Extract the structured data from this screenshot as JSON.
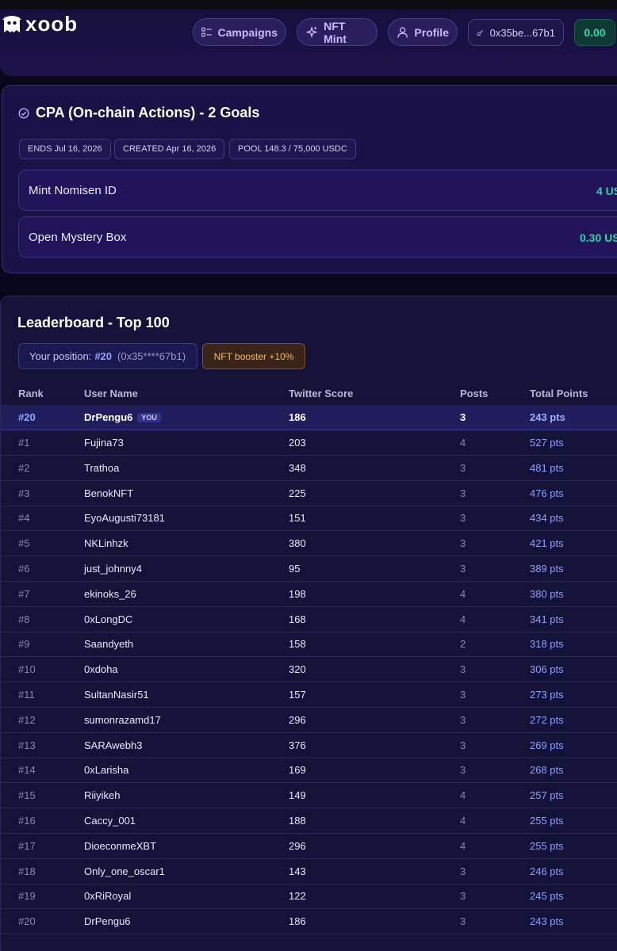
{
  "brand": {
    "name": "xoob"
  },
  "nav": {
    "campaigns": "Campaigns",
    "nft_mint": "NFT Mint",
    "profile": "Profile",
    "wallet": "0x35be...67b1",
    "balance": "0.00"
  },
  "cpa": {
    "title": "CPA (On-chain Actions) - 2 Goals",
    "chips": [
      "ENDS Jul 16, 2026",
      "CREATED Apr 16, 2026",
      "POOL 148.3 / 75,000 USDC"
    ],
    "goals": [
      {
        "name": "Mint Nomisen ID",
        "reward": "4 US"
      },
      {
        "name": "Open Mystery Box",
        "reward": "0.30 US"
      }
    ]
  },
  "leaderboard": {
    "title": "Leaderboard - Top 100",
    "position_label": "Your position:",
    "position_rank": "#20",
    "position_address": "(0x35****67b1)",
    "booster": "NFT booster +10%",
    "columns": [
      "Rank",
      "User Name",
      "Twitter Score",
      "Posts",
      "Total Points"
    ],
    "you_badge": "YOU",
    "me_row": {
      "rank": "#20",
      "user": "DrPengu6",
      "score": "186",
      "posts": "3",
      "points": "243 pts"
    },
    "rows": [
      {
        "rank": "#1",
        "user": "Fujina73",
        "score": "203",
        "posts": "4",
        "points": "527 pts"
      },
      {
        "rank": "#2",
        "user": "Trathoa",
        "score": "348",
        "posts": "3",
        "points": "481 pts"
      },
      {
        "rank": "#3",
        "user": "BenokNFT",
        "score": "225",
        "posts": "3",
        "points": "476 pts"
      },
      {
        "rank": "#4",
        "user": "EyoAugusti73181",
        "score": "151",
        "posts": "3",
        "points": "434 pts"
      },
      {
        "rank": "#5",
        "user": "NKLinhzk",
        "score": "380",
        "posts": "3",
        "points": "421 pts"
      },
      {
        "rank": "#6",
        "user": "just_johnny4",
        "score": "95",
        "posts": "3",
        "points": "389 pts"
      },
      {
        "rank": "#7",
        "user": "ekinoks_26",
        "score": "198",
        "posts": "4",
        "points": "380 pts"
      },
      {
        "rank": "#8",
        "user": "0xLongDC",
        "score": "168",
        "posts": "4",
        "points": "341 pts"
      },
      {
        "rank": "#9",
        "user": "Saandyeth",
        "score": "158",
        "posts": "2",
        "points": "318 pts"
      },
      {
        "rank": "#10",
        "user": "0xdoha",
        "score": "320",
        "posts": "3",
        "points": "306 pts"
      },
      {
        "rank": "#11",
        "user": "SultanNasir51",
        "score": "157",
        "posts": "3",
        "points": "273 pts"
      },
      {
        "rank": "#12",
        "user": "sumonrazamd17",
        "score": "296",
        "posts": "3",
        "points": "272 pts"
      },
      {
        "rank": "#13",
        "user": "SARAwebh3",
        "score": "376",
        "posts": "3",
        "points": "269 pts"
      },
      {
        "rank": "#14",
        "user": "0xLarisha",
        "score": "169",
        "posts": "3",
        "points": "268 pts"
      },
      {
        "rank": "#15",
        "user": "Riiyikeh",
        "score": "149",
        "posts": "4",
        "points": "257 pts"
      },
      {
        "rank": "#16",
        "user": "Caccy_001",
        "score": "188",
        "posts": "4",
        "points": "255 pts"
      },
      {
        "rank": "#17",
        "user": "DioeconmeXBT",
        "score": "296",
        "posts": "4",
        "points": "255 pts"
      },
      {
        "rank": "#18",
        "user": "Only_one_oscar1",
        "score": "143",
        "posts": "3",
        "points": "246 pts"
      },
      {
        "rank": "#19",
        "user": "0xRiRoyal",
        "score": "122",
        "posts": "3",
        "points": "245 pts"
      },
      {
        "rank": "#20",
        "user": "DrPengu6",
        "score": "186",
        "posts": "3",
        "points": "243 pts"
      }
    ]
  },
  "colors": {
    "accent": "#8fa0ff",
    "reward": "#34d3a3",
    "booster": "#f4b86a",
    "card": "#1a1146"
  }
}
